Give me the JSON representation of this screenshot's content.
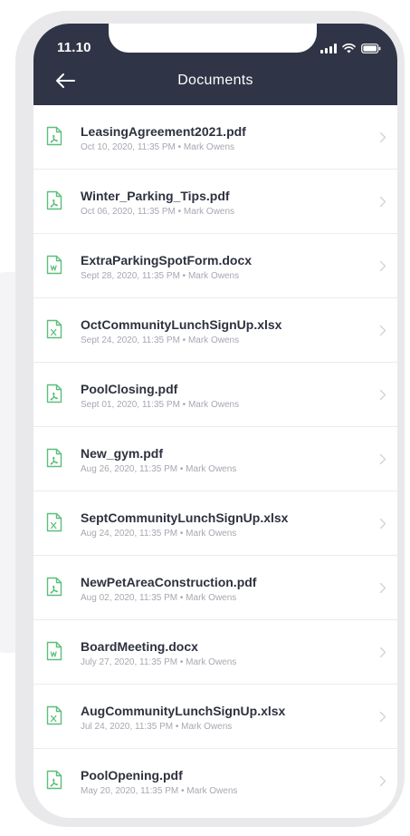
{
  "status_bar": {
    "time": "11.10"
  },
  "header": {
    "title": "Documents"
  },
  "colors": {
    "header_bg": "#2f3546",
    "icon_green": "#5bbf7a",
    "title_text": "#2e3140",
    "meta_text": "#a6a8b1"
  },
  "documents": [
    {
      "icon": "pdf-file-icon",
      "name": "LeasingAgreement2021.pdf",
      "meta": "Oct 10, 2020, 11:35 PM • Mark Owens"
    },
    {
      "icon": "pdf-file-icon",
      "name": "Winter_Parking_Tips.pdf",
      "meta": "Oct 06, 2020, 11:35 PM • Mark Owens"
    },
    {
      "icon": "word-file-icon",
      "name": "ExtraParkingSpotForm.docx",
      "meta": "Sept 28, 2020, 11:35 PM • Mark Owens"
    },
    {
      "icon": "excel-file-icon",
      "name": "OctCommunityLunchSignUp.xlsx",
      "meta": "Sept 24, 2020, 11:35 PM • Mark Owens"
    },
    {
      "icon": "pdf-file-icon",
      "name": "PoolClosing.pdf",
      "meta": "Sept 01, 2020, 11:35 PM • Mark Owens"
    },
    {
      "icon": "pdf-file-icon",
      "name": "New_gym.pdf",
      "meta": "Aug 26, 2020, 11:35 PM • Mark Owens"
    },
    {
      "icon": "excel-file-icon",
      "name": "SeptCommunityLunchSignUp.xlsx",
      "meta": "Aug 24, 2020, 11:35 PM • Mark Owens"
    },
    {
      "icon": "pdf-file-icon",
      "name": "NewPetAreaConstruction.pdf",
      "meta": "Aug 02, 2020, 11:35 PM • Mark Owens"
    },
    {
      "icon": "word-file-icon",
      "name": "BoardMeeting.docx",
      "meta": "July 27, 2020, 11:35 PM • Mark Owens"
    },
    {
      "icon": "excel-file-icon",
      "name": "AugCommunityLunchSignUp.xlsx",
      "meta": "Jul 24, 2020, 11:35 PM • Mark Owens"
    },
    {
      "icon": "pdf-file-icon",
      "name": "PoolOpening.pdf",
      "meta": "May 20, 2020, 11:35 PM • Mark Owens"
    }
  ]
}
